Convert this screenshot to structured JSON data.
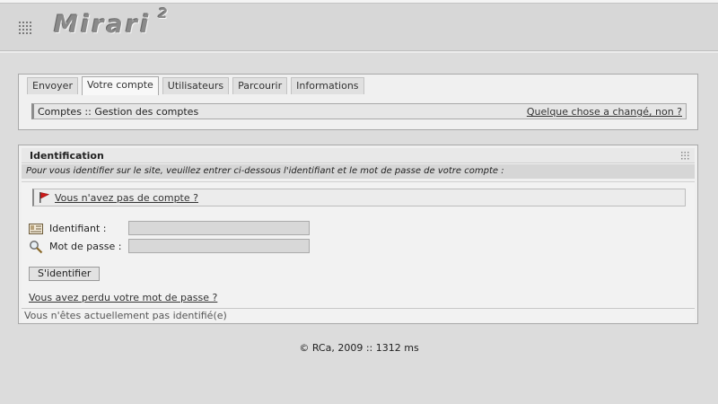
{
  "app": {
    "logo_text": "Mirari",
    "logo_sup": "2"
  },
  "icons": {
    "menu": "grid-icon",
    "panel_menu": "grid-icon",
    "no_account": "red-flag-icon",
    "login": "id-card-icon",
    "password": "magnifier-key-icon"
  },
  "nav": {
    "tabs": [
      {
        "label": "Envoyer"
      },
      {
        "label": "Votre compte",
        "active": true
      },
      {
        "label": "Utilisateurs"
      },
      {
        "label": "Parcourir"
      },
      {
        "label": "Informations"
      }
    ],
    "breadcrumb": "Comptes :: Gestion des comptes",
    "changed_link": "Quelque chose a changé, non ?"
  },
  "identification": {
    "title": "Identification",
    "intro": "Pour vous identifier sur le site, veuillez entrer ci-dessous l'identifiant et le mot de passe de votre compte :",
    "no_account_link": "Vous n'avez pas de compte ?",
    "login_label": "Identifiant :",
    "login_value": "",
    "password_label": "Mot de passe :",
    "password_value": "",
    "submit_label": "S'identifier",
    "lost_password_link": "Vous avez perdu votre mot de passe ?",
    "status": "Vous n'êtes actuellement pas identifié(e)"
  },
  "footer": {
    "text": "© RCa, 2009 :: 1312 ms"
  },
  "colors": {
    "background": "#dcdcdc",
    "panel": "#f0f0f0",
    "flag": "#cc1a1a"
  }
}
